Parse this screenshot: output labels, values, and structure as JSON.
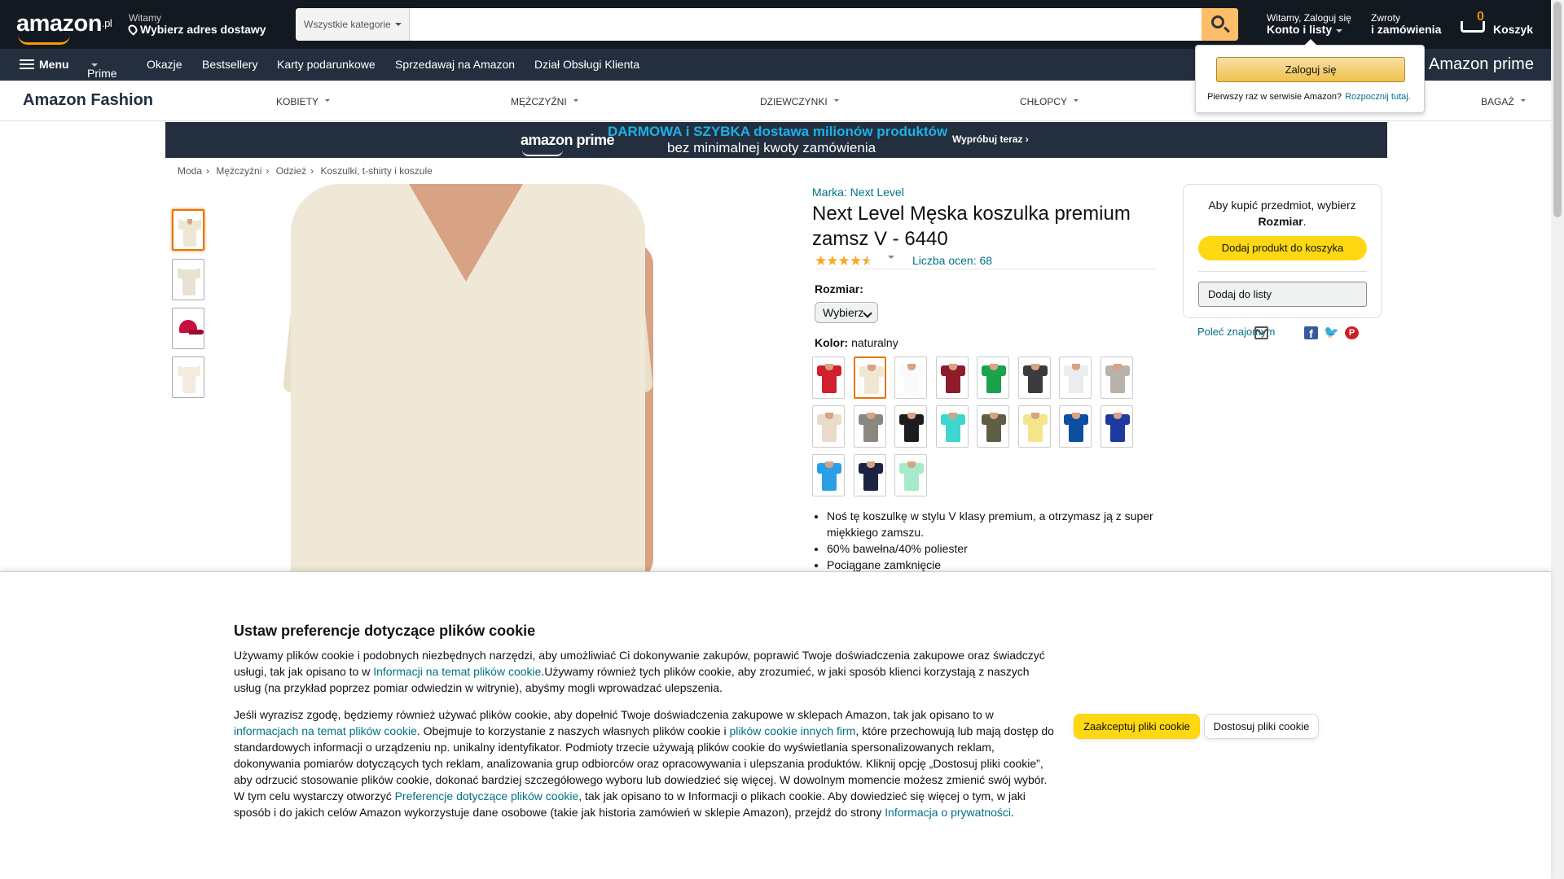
{
  "header": {
    "logo": "amazon",
    "logo_tld": ".pl",
    "greeting": "Witamy",
    "deliver": "Wybierz adres dostawy",
    "search_category": "Wszystkie kategorie",
    "search_placeholder": "",
    "account_top": "Witamy, Zaloguj się",
    "account_bottom": "Konto i listy",
    "orders_top": "Zwroty",
    "orders_bottom": "i zamówienia",
    "cart_count": "0",
    "cart_label": "Koszyk"
  },
  "subnav": {
    "menu": "Menu",
    "items": [
      "Prime",
      "Okazje",
      "Bestsellery",
      "Karty podarunkowe",
      "Sprzedawaj na Amazon",
      "Dział Obsługi Klienta"
    ],
    "prime_brand": "Amazon prime"
  },
  "fashion": {
    "brand": "Amazon Fashion",
    "categories": [
      "KOBIETY",
      "MĘŻCZYŹNI",
      "DZIEWCZYNKI",
      "CHŁOPCY",
      "BAGAŻ"
    ]
  },
  "signin_flyout": {
    "button": "Zaloguj się",
    "new_customer": "Pierwszy raz w serwisie Amazon?",
    "start_link": "Rozpocznij tutaj."
  },
  "banner": {
    "brand": "amazon prime",
    "line1": "DARMOWA i SZYBKA dostawa milionów produktów",
    "line2": "bez minimalnej kwoty zamówienia",
    "cta": "Wypróbuj teraz ›"
  },
  "breadcrumbs": [
    "Moda",
    "Mężczyźni",
    "Odzież",
    "Koszulki, t-shirty i koszule"
  ],
  "product": {
    "brand_link": "Marka: Next Level",
    "title": "Next Level Męska koszulka premium zamsz V - 6440",
    "rating": 4.5,
    "ratings_count": "Liczba ocen: 68",
    "size_label": "Rozmiar:",
    "size_value": "Wybierz",
    "color_label": "Kolor:",
    "color_value": "naturalny",
    "swatch_colors": [
      "#d21f2b",
      "#efe7d4",
      "#fafafa",
      "#8e1a2a",
      "#1aa34a",
      "#3b3b3d",
      "#e9edf0",
      "#b9b2ab",
      "#e8dcc8",
      "#8a8780",
      "#1c1c1e",
      "#3fd5d0",
      "#5e5e44",
      "#f5e58a",
      "#0c4fa0",
      "#1e3a9e",
      "#2b9fe6",
      "#1b2440",
      "#a5ebc9"
    ],
    "thumb_colors": [
      "#efe7d4",
      "#e8e2d3",
      "#c8103e",
      "#f3ecde"
    ],
    "bullets": [
      "Noś tę koszulkę w stylu V klasy premium, a otrzymasz ją z super miękkiego zamszu.",
      "60% bawełna/40% poliester",
      "Pociągane zamknięcie"
    ]
  },
  "buybox": {
    "msg_pre": "Aby kupić przedmiot, wybierz",
    "msg_bold": "Rozmiar",
    "msg_post": ".",
    "add_to_cart": "Dodaj produkt do koszyka",
    "add_to_list": "Dodaj do listy",
    "share": "Poleć znajomym"
  },
  "cookie": {
    "title": "Ustaw preferencje dotyczące plików cookie",
    "p1_a": "Używamy plików cookie i podobnych niezbędnych narzędzi, aby umożliwiać Ci dokonywanie zakupów, poprawić Twoje doświadczenia zakupowe oraz świadczyć usługi, tak jak opisano to w ",
    "p1_link": "Informacji na temat plików cookie",
    "p1_b": ".Używamy również tych plików cookie, aby zrozumieć, w jaki sposób klienci korzystają z naszych usług (na przykład poprzez pomiar odwiedzin w witrynie), abyśmy mogli wprowadzać ulepszenia.",
    "p2_a": "Jeśli wyrazisz zgodę, będziemy również używać plików cookie, aby dopełnić Twoje doświadczenia zakupowe w sklepach Amazon, tak jak opisano to w ",
    "p2_link1": "informacjach na temat plików cookie",
    "p2_b": ". Obejmuje to korzystanie z naszych własnych plików cookie i ",
    "p2_link2": "plików cookie innych firm",
    "p2_c": ", które przechowują lub mają dostęp do standardowych informacji o urządzeniu np. unikalny identyfikator. Podmioty trzecie używają plików cookie do wyświetlania spersonalizowanych reklam, dokonywania pomiarów dotyczących tych reklam, analizowania grup odbiorców oraz opracowywania i ulepszania produktów. Kliknij opcję „Dostosuj pliki cookie”, aby odrzucić stosowanie plików cookie, dokonać bardziej szczegółowego wyboru lub dowiedzieć się więcej. W dowolnym momencie możesz zmienić swój wybór. W tym celu wystarczy otworzyć ",
    "p2_link3": "Preferencje dotyczące plików cookie",
    "p2_d": ", tak jak opisano to w Informacji o plikach cookie. Aby dowiedzieć się więcej o tym, w jaki sposób i do jakich celów Amazon wykorzystuje dane osobowe (takie jak historia zamówień w sklepie Amazon), przejdź do strony ",
    "p2_link4": "Informacja o prywatności",
    "p2_e": ".",
    "accept": "Zaakceptuj pliki cookie",
    "customize": "Dostosuj pliki cookie"
  }
}
